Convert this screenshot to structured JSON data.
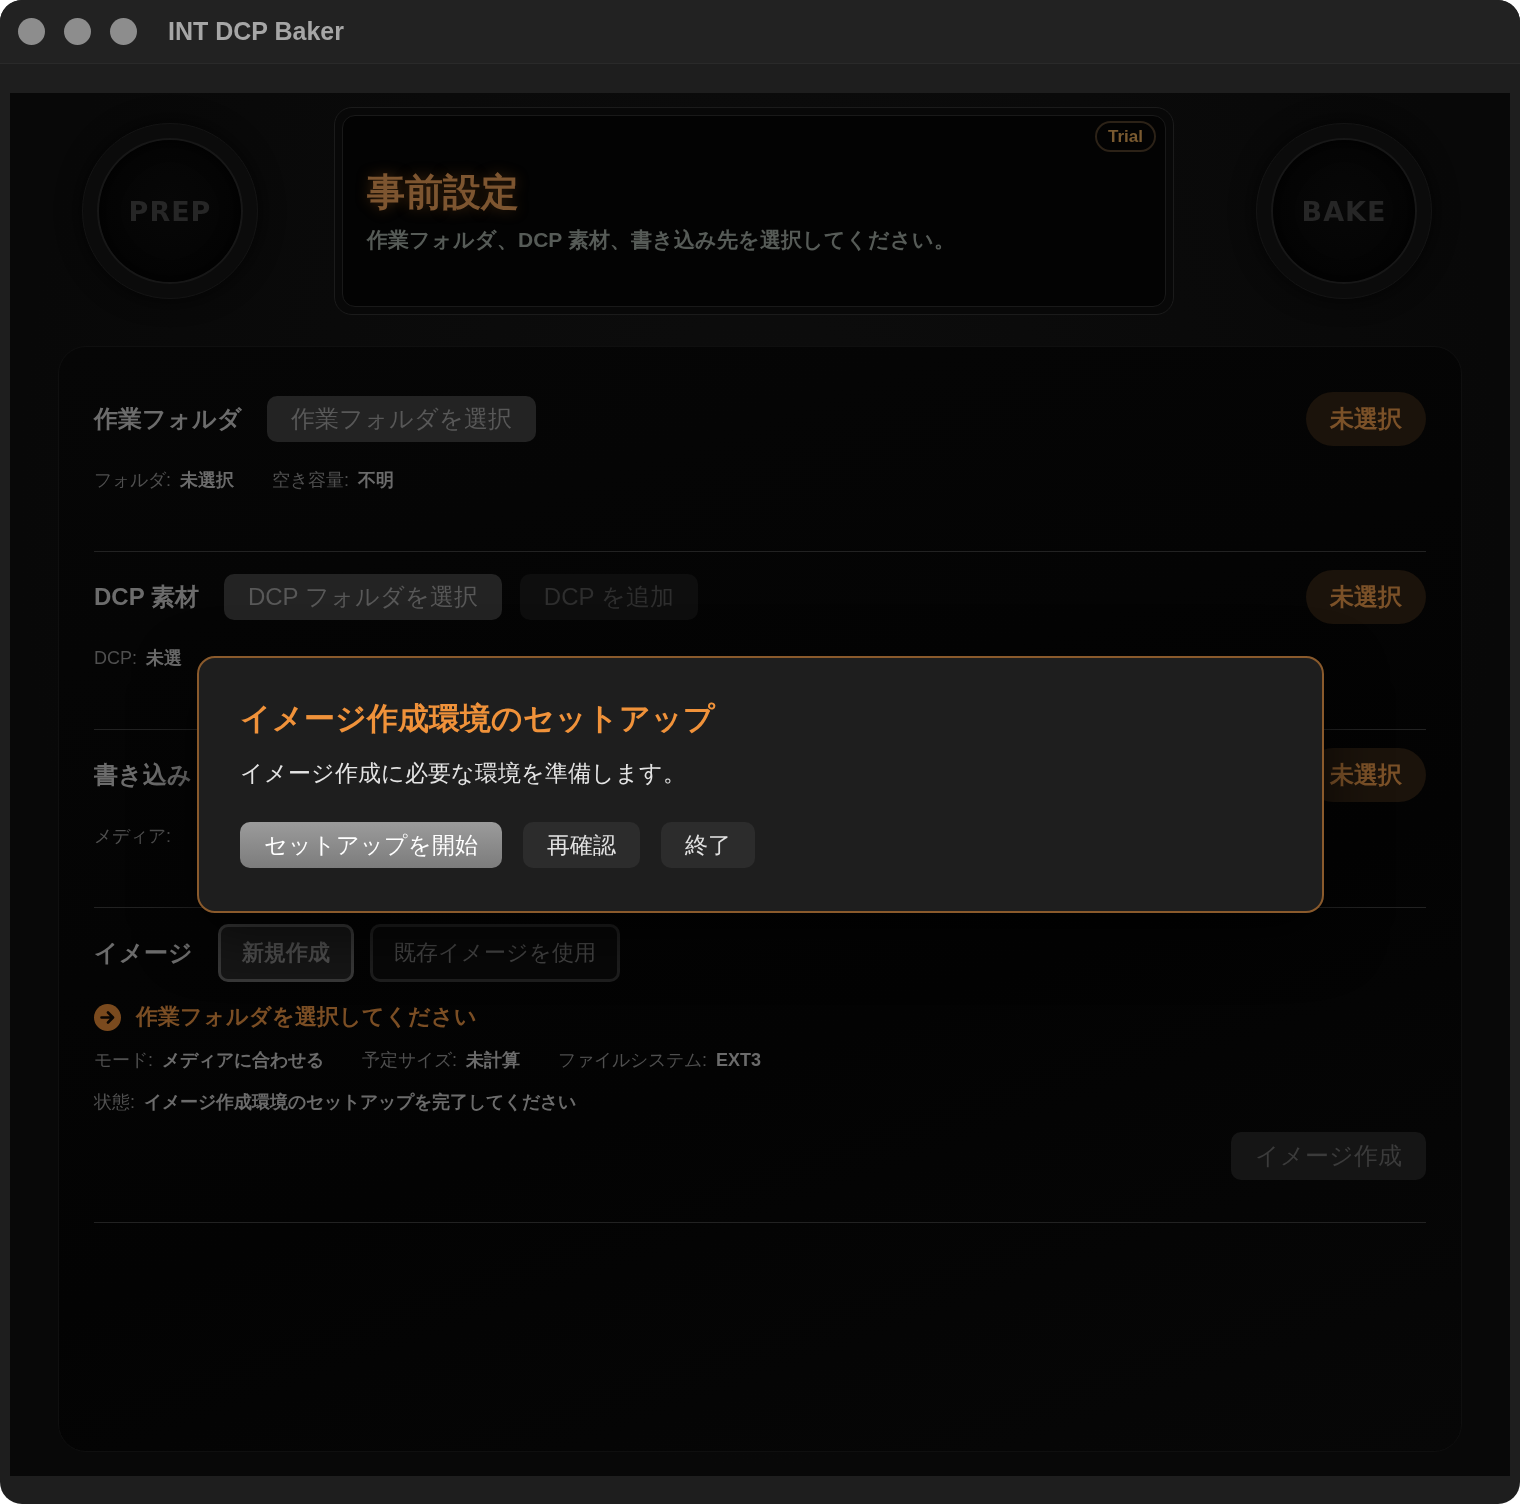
{
  "window": {
    "title": "INT DCP Baker"
  },
  "knobs": [
    {
      "label": "PREP"
    },
    {
      "label": "BAKE"
    }
  ],
  "header": {
    "title": "事前設定",
    "subtitle": "作業フォルダ、DCP 素材、書き込み先を選択してください。",
    "badge": "Trial"
  },
  "sections": [
    {
      "label": "作業フォルダ",
      "buttons": [
        {
          "label": "作業フォルダを選択",
          "disabled": false
        }
      ],
      "status": "未選択",
      "meta": [
        [
          {
            "label": "フォルダ:",
            "value": "未選択"
          },
          {
            "label": "空き容量:",
            "value": "不明"
          }
        ]
      ]
    },
    {
      "label": "DCP 素材",
      "buttons": [
        {
          "label": "DCP フォルダを選択",
          "disabled": false
        },
        {
          "label": "DCP を追加",
          "disabled": true
        }
      ],
      "status": "未選択",
      "meta": [
        [
          {
            "label": "DCP:",
            "value": "未選"
          }
        ]
      ]
    },
    {
      "label": "書き込み",
      "status": "未選択",
      "meta": [
        [
          {
            "label": "メディア:"
          }
        ]
      ]
    },
    {
      "label": "イメージ",
      "modes": [
        {
          "label": "新規作成",
          "selected": true
        },
        {
          "label": "既存イメージを使用",
          "selected": false
        }
      ],
      "hint": "作業フォルダを選択してください",
      "meta": [
        [
          {
            "label": "モード:",
            "value": "メディアに合わせる"
          },
          {
            "label": "予定サイズ:",
            "value": "未計算"
          },
          {
            "label": "ファイルシステム:",
            "value": "EXT3"
          }
        ],
        [
          {
            "label": "状態:",
            "value": "イメージ作成環境のセットアップを完了してください"
          }
        ]
      ],
      "action": {
        "label": "イメージ作成",
        "disabled": true
      }
    }
  ],
  "dialog": {
    "title": "イメージ作成環境のセットアップ",
    "message": "イメージ作成に必要な環境を準備します。",
    "buttons": [
      {
        "label": "セットアップを開始",
        "kind": "primary"
      },
      {
        "label": "再確認",
        "kind": "secondary"
      },
      {
        "label": "終了",
        "kind": "secondary"
      }
    ]
  }
}
